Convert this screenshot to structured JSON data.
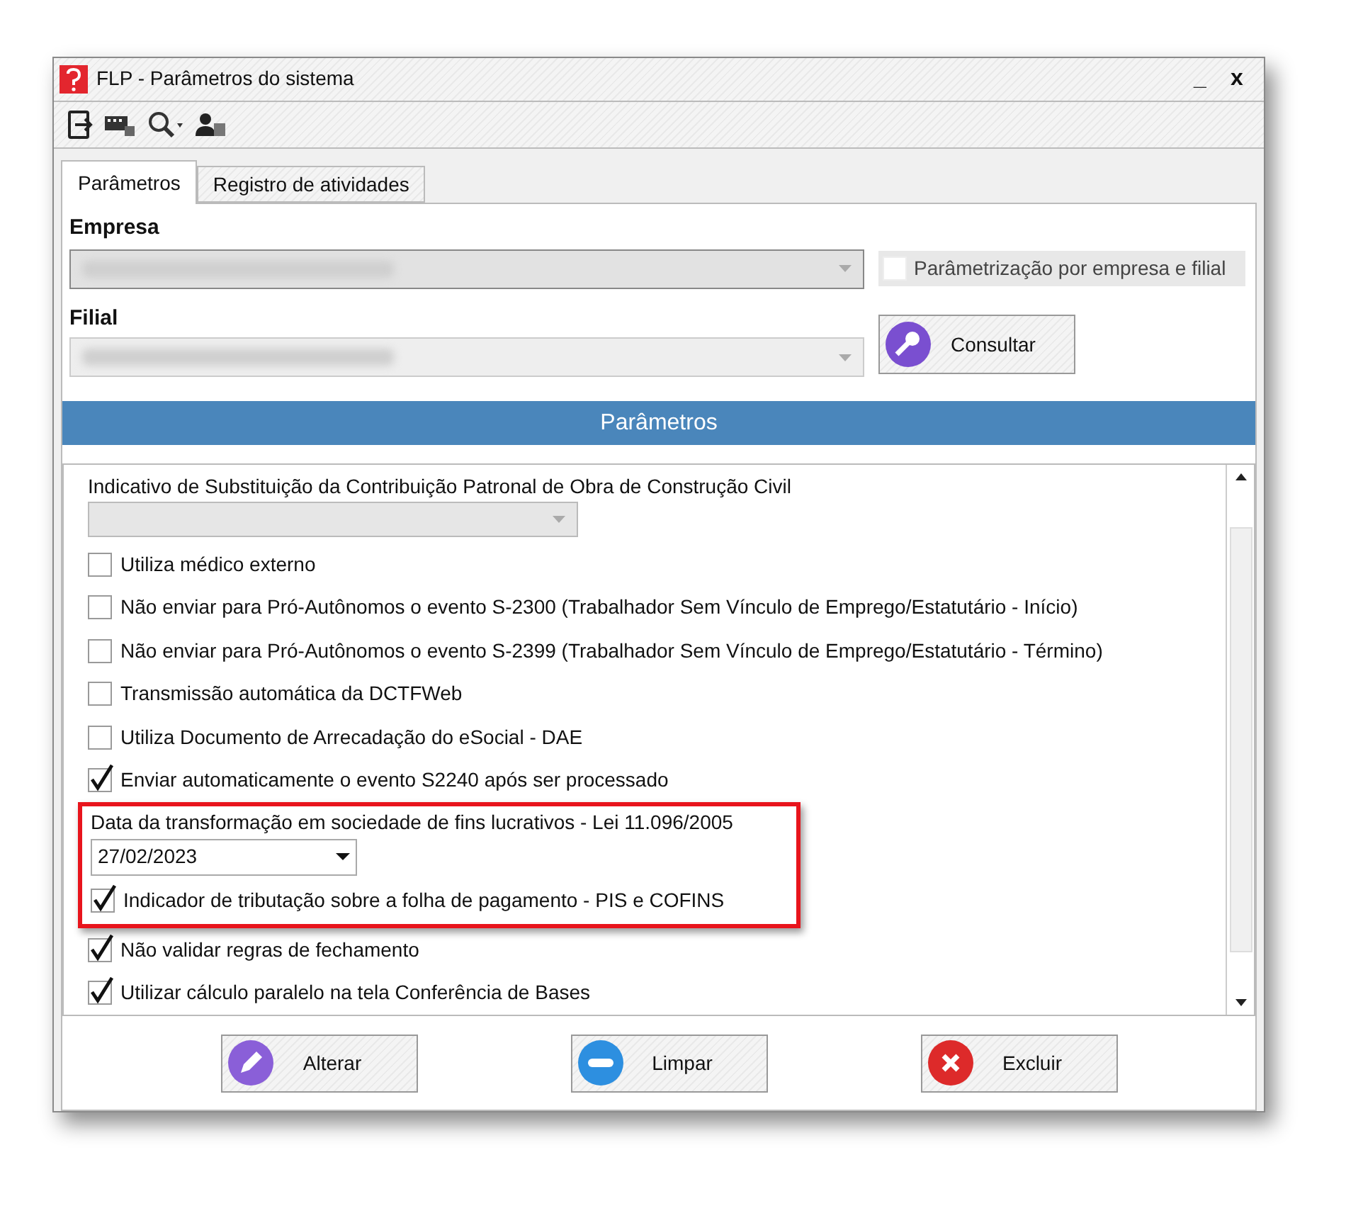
{
  "window": {
    "title": "FLP - Parâmetros do sistema",
    "minimize": "_",
    "close": "x"
  },
  "tabs": [
    {
      "label": "Parâmetros",
      "selected": true
    },
    {
      "label": "Registro de atividades",
      "selected": false
    }
  ],
  "empresa": {
    "label": "Empresa",
    "checkbox": {
      "label": "Parâmetrização por empresa e filial",
      "checked": false
    }
  },
  "filial": {
    "label": "Filial",
    "button": "Consultar"
  },
  "section_header": "Parâmetros",
  "items": [
    {
      "kind": "label",
      "text": "Indicativo de Substituição da Contribuição Patronal de Obra de Construção Civil"
    },
    {
      "kind": "select",
      "disabled": true
    },
    {
      "kind": "checkbox",
      "label": "Utiliza médico externo",
      "checked": false
    },
    {
      "kind": "checkbox",
      "label": "Não enviar para Pró-Autônomos o evento S-2300 (Trabalhador Sem Vínculo de Emprego/Estatutário - Início)",
      "checked": false
    },
    {
      "kind": "checkbox",
      "label": "Não enviar para Pró-Autônomos o evento S-2399 (Trabalhador Sem Vínculo de Emprego/Estatutário - Término)",
      "checked": false
    },
    {
      "kind": "checkbox",
      "label": "Transmissão automática da DCTFWeb",
      "checked": false
    },
    {
      "kind": "checkbox",
      "label": "Utiliza Documento de Arrecadação do eSocial - DAE",
      "checked": false
    },
    {
      "kind": "checkbox",
      "label": "Enviar automaticamente o evento S2240 após ser processado",
      "checked": true
    },
    {
      "kind": "highlight",
      "children": [
        {
          "kind": "label",
          "text": "Data da transformação em sociedade de fins lucrativos - Lei 11.096/2005"
        },
        {
          "kind": "date",
          "value": "27/02/2023"
        },
        {
          "kind": "checkbox",
          "label": "Indicador de tributação sobre a folha de pagamento - PIS e COFINS",
          "checked": true
        }
      ]
    },
    {
      "kind": "checkbox",
      "label": "Não validar regras de fechamento",
      "checked": true
    },
    {
      "kind": "checkbox",
      "label": "Utilizar cálculo paralelo na tela Conferência de Bases",
      "checked": true
    }
  ],
  "buttons": [
    {
      "kind": "edit",
      "label": "Alterar"
    },
    {
      "kind": "clear",
      "label": "Limpar"
    },
    {
      "kind": "delete",
      "label": "Excluir"
    }
  ]
}
